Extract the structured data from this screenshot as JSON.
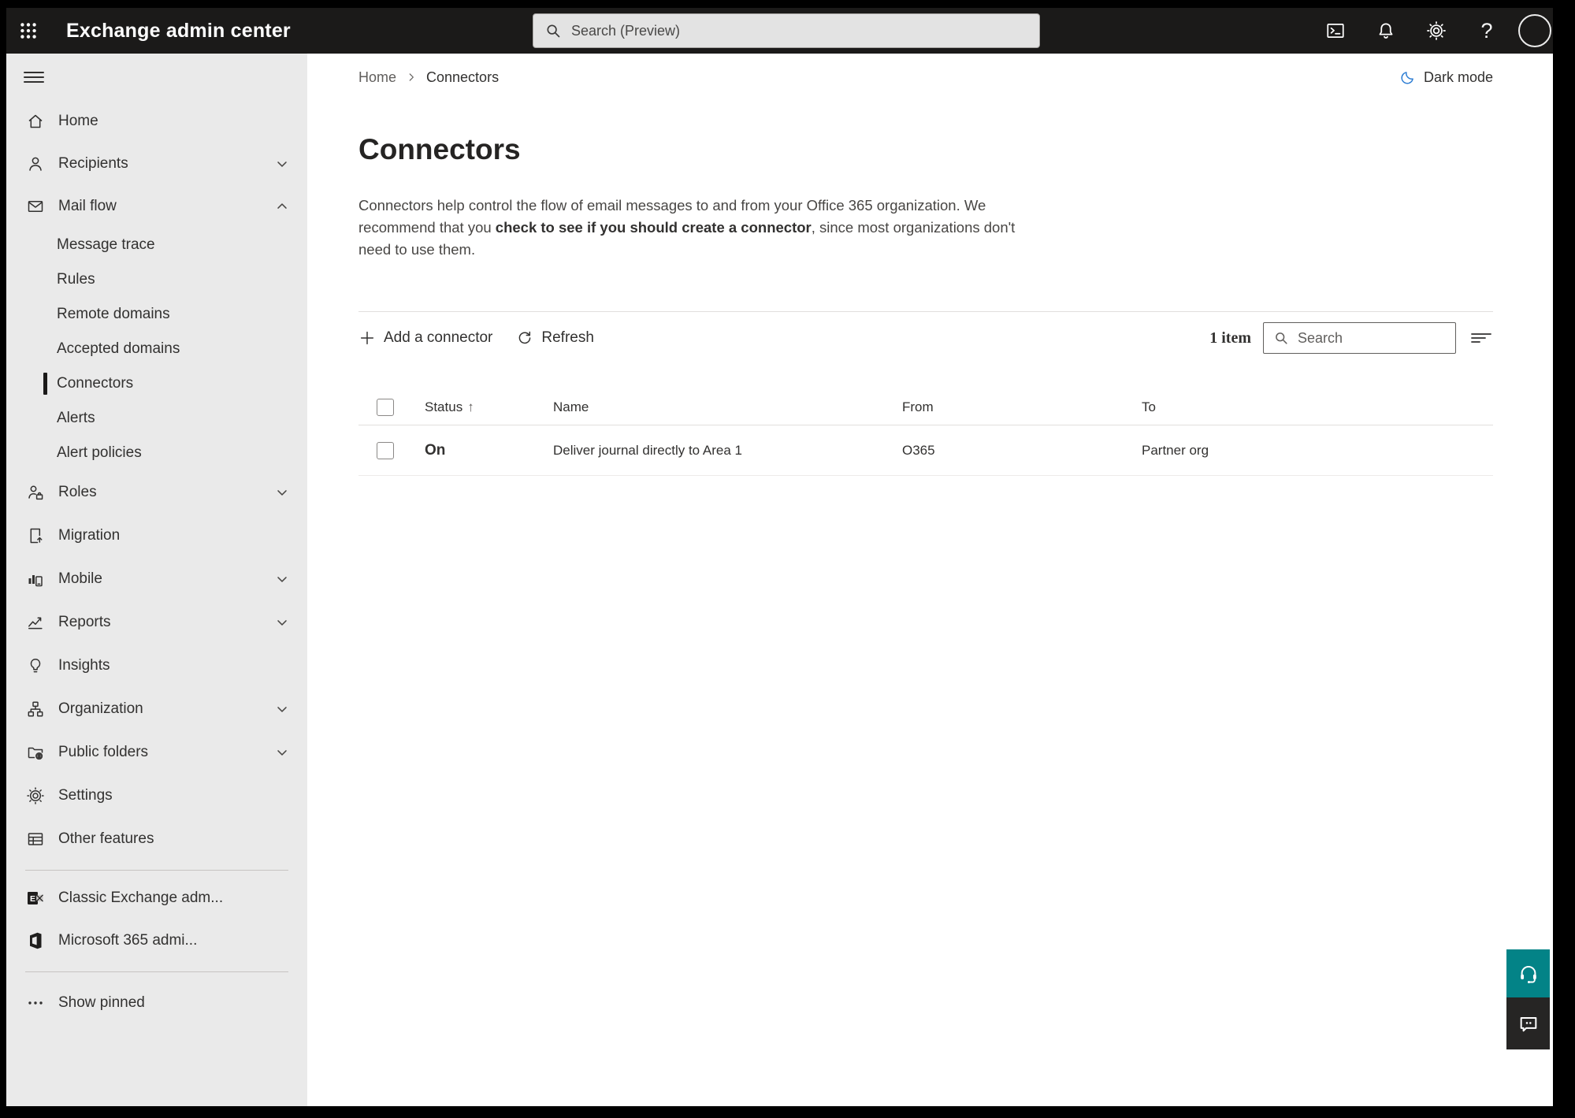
{
  "topbar": {
    "title": "Exchange admin center",
    "search_placeholder": "Search (Preview)"
  },
  "breadcrumb": {
    "home": "Home",
    "current": "Connectors"
  },
  "dark_mode_label": "Dark mode",
  "sidebar": {
    "items": [
      {
        "label": "Home",
        "icon": "home"
      },
      {
        "label": "Recipients",
        "icon": "person",
        "chevron": "down"
      },
      {
        "label": "Mail flow",
        "icon": "envelope",
        "chevron": "up"
      },
      {
        "label": "Message trace"
      },
      {
        "label": "Rules"
      },
      {
        "label": "Remote domains"
      },
      {
        "label": "Accepted domains"
      },
      {
        "label": "Connectors",
        "selected": true
      },
      {
        "label": "Alerts"
      },
      {
        "label": "Alert policies"
      },
      {
        "label": "Roles",
        "icon": "person-briefcase",
        "chevron": "down"
      },
      {
        "label": "Migration",
        "icon": "document-arrow"
      },
      {
        "label": "Mobile",
        "icon": "chart-phone",
        "chevron": "down"
      },
      {
        "label": "Reports",
        "icon": "line-chart",
        "chevron": "down"
      },
      {
        "label": "Insights",
        "icon": "lightbulb"
      },
      {
        "label": "Organization",
        "icon": "org-chart",
        "chevron": "down"
      },
      {
        "label": "Public folders",
        "icon": "folder-globe",
        "chevron": "down"
      },
      {
        "label": "Settings",
        "icon": "gear"
      },
      {
        "label": "Other features",
        "icon": "table"
      },
      {
        "label": "Classic Exchange adm...",
        "icon": "exchange-logo"
      },
      {
        "label": "Microsoft 365 admi...",
        "icon": "microsoft-365-logo"
      },
      {
        "label": "Show pinned",
        "icon": "ellipsis"
      }
    ]
  },
  "page": {
    "title": "Connectors",
    "description_part1": "Connectors help control the flow of email messages to and from your Office 365 organization. We recommend that you ",
    "description_emphasis": "check to see if you should create a connector",
    "description_part2": ", since most organizations don't need to use them."
  },
  "toolbar": {
    "add_label": "Add a connector",
    "refresh_label": "Refresh",
    "item_count": "1 item",
    "search_placeholder": "Search"
  },
  "table": {
    "headers": [
      "Status",
      "Name",
      "From",
      "To"
    ],
    "sort_ascending_glyph": "↑",
    "rows": [
      {
        "status": "On",
        "name": "Deliver journal directly to Area 1",
        "from": "O365",
        "to": "Partner org"
      }
    ]
  },
  "colors": {
    "topbar_bg": "#1b1a19",
    "sidebar_bg": "#eaeaea",
    "selected_indicator": "#1b1a19",
    "dark_mode_icon": "#2b7cd3",
    "support_button": "#038387",
    "feedback_button": "#262524"
  }
}
